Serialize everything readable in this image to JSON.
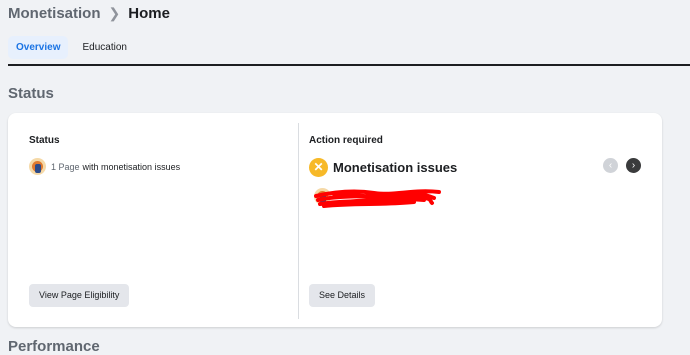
{
  "breadcrumb": {
    "parent": "Monetisation",
    "separator": ">",
    "current": "Home"
  },
  "tabs": [
    {
      "label": "Overview",
      "active": true
    },
    {
      "label": "Education",
      "active": false
    }
  ],
  "sections": {
    "status": "Status",
    "performance": "Performance"
  },
  "status_card": {
    "left": {
      "title": "Status",
      "count_text": "1 Page",
      "issue_text": "with monetisation issues",
      "button_label": "View Page Eligibility"
    },
    "right": {
      "title": "Action required",
      "issue_title": "Monetisation issues",
      "badge_icon": "x-icon",
      "button_label": "See Details"
    }
  },
  "colors": {
    "accent": "#1b74e4",
    "warning": "#f7b928",
    "redaction": "#ff0000"
  }
}
